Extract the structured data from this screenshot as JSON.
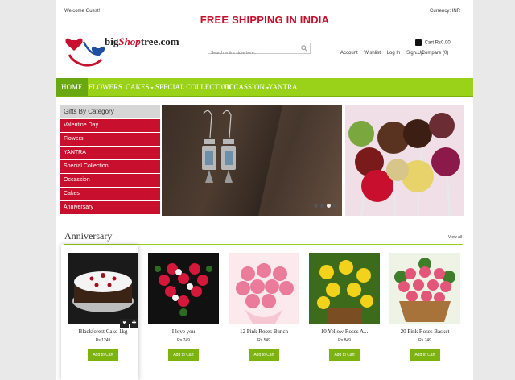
{
  "topbar": {
    "welcome": "Welcome Guest!",
    "currency_label": "Currency: INR",
    "shipping_banner": "FREE SHIPPING IN INDIA"
  },
  "logo": {
    "prefix": "big",
    "middle": "Shop",
    "suffix": "tree.com"
  },
  "search": {
    "placeholder": "Search entire store here..."
  },
  "cart": {
    "label": "Cart Rs0.00"
  },
  "account_links": [
    "Account",
    "Wishlist",
    "Log In",
    "Sign Up"
  ],
  "compare": {
    "label": "Compare (0)"
  },
  "nav": {
    "items": [
      {
        "label": "HOME"
      },
      {
        "label": "FLOWERS"
      },
      {
        "label": "CAKES"
      },
      {
        "label": "SPECIAL COLLECTION"
      },
      {
        "label": "OCCASSION"
      },
      {
        "label": "YANTRA"
      }
    ]
  },
  "sidebar": {
    "heading": "Gifts By Category",
    "items": [
      {
        "label": "Valentine Day"
      },
      {
        "label": "Flowers"
      },
      {
        "label": "YANTRA"
      },
      {
        "label": "Special Collection"
      },
      {
        "label": "Occassion"
      },
      {
        "label": "Cakes"
      },
      {
        "label": "Anniversary"
      }
    ]
  },
  "slider": {
    "dots": 4,
    "active_dot": 3
  },
  "section": {
    "title": "Anniversary",
    "view_all": "View All"
  },
  "products": [
    {
      "name": "Blackforest Cake 1kg",
      "price": "Rs 1249",
      "button": "Add to Cart"
    },
    {
      "name": "I love you",
      "price": "Rs 749",
      "button": "Add to Cart"
    },
    {
      "name": "12 Pink Roses Bunch",
      "price": "Rs 549",
      "button": "Add to Cart"
    },
    {
      "name": "10 Yellow Roses A...",
      "price": "Rs 849",
      "button": "Add to Cart"
    },
    {
      "name": "20 Pink Roses Basket",
      "price": "Rs 749",
      "button": "Add to Cart"
    }
  ],
  "colors": {
    "brand_red": "#c8102e",
    "nav_green": "#9ad21a",
    "button_green": "#7cb30e"
  }
}
